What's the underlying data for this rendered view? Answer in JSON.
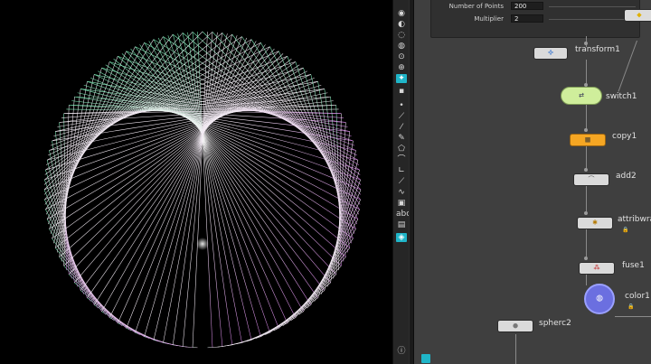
{
  "parameters": {
    "number_of_points_label": "Number of Points",
    "number_of_points_value": "200",
    "multiplier_label": "Multiplier",
    "multiplier_value": "2"
  },
  "nodes": {
    "transform": "transform1",
    "switch": "switch1",
    "copy": "copy1",
    "add": "add2",
    "attribwrangle": "attribwra",
    "fuse": "fuse1",
    "color": "color1",
    "sphere": "spherc2"
  },
  "shelf": {
    "abc_label": "abc"
  },
  "icons": [
    "lock-icon",
    "pin-icon",
    "camera-icon",
    "transform-icon",
    "copy-icon",
    "fuse-icon",
    "color-icon",
    "sphere-icon",
    "wrangle-icon",
    "add-icon",
    "switch-icon"
  ],
  "colors": {
    "viewport_bg": "#000000",
    "network_bg": "#3f3f3f",
    "copy_node": "#f5a623",
    "switch_node": "#cfee9b",
    "color_node": "#6b6fe0",
    "gradient_green": "#7fe8b0",
    "gradient_white": "#f4f4f4",
    "gradient_pink": "#e58ee6"
  }
}
